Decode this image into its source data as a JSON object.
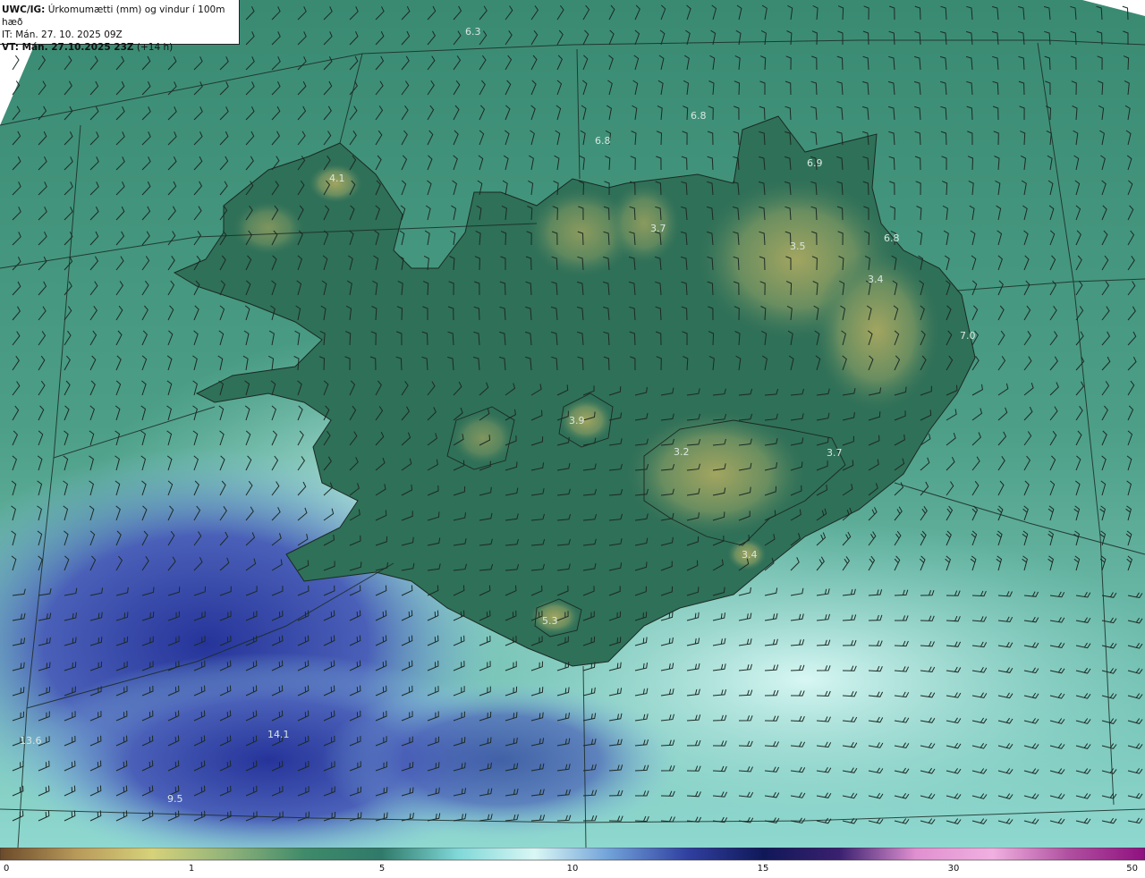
{
  "header": {
    "line1_bold": "UWC/IG:",
    "line1_rest": " Úrkomumætti (mm) og vindur í 100m hæð",
    "line2": "IT: Mán. 27. 10. 2025 09Z",
    "line3_bold": "VT: Mán. 27.10.2025 23Z",
    "line3_rest": " (+14 h)"
  },
  "map_values": [
    "6.3",
    "6.8",
    "6.8",
    "6.9",
    "4.1",
    "3.7",
    "3.5",
    "6.8",
    "3.4",
    "7.0",
    "3.9",
    "3.2",
    "3.7",
    "3.4",
    "5.3",
    "14.1",
    "13.6",
    "9.5"
  ],
  "colorbar": {
    "ticks": [
      "0",
      "1",
      "5",
      "10",
      "15",
      "30",
      "50"
    ],
    "stops": [
      "#6b4a2a",
      "#b89a5a",
      "#d6d27a",
      "#8fb27a",
      "#3e8a6a",
      "#2f7a6a",
      "#7fd8d8",
      "#d9f7f5",
      "#6fa0d8",
      "#3040a0",
      "#101858",
      "#3a2070",
      "#e090d0",
      "#f0b0e0",
      "#b050a0",
      "#901080"
    ]
  },
  "colors": {
    "land_dark": "#2f6d55",
    "land_high": "#8a9a5a",
    "sea_green": "#3f8f78",
    "sea_light": "#bff0ec",
    "sea_blue": "#3848a8"
  }
}
